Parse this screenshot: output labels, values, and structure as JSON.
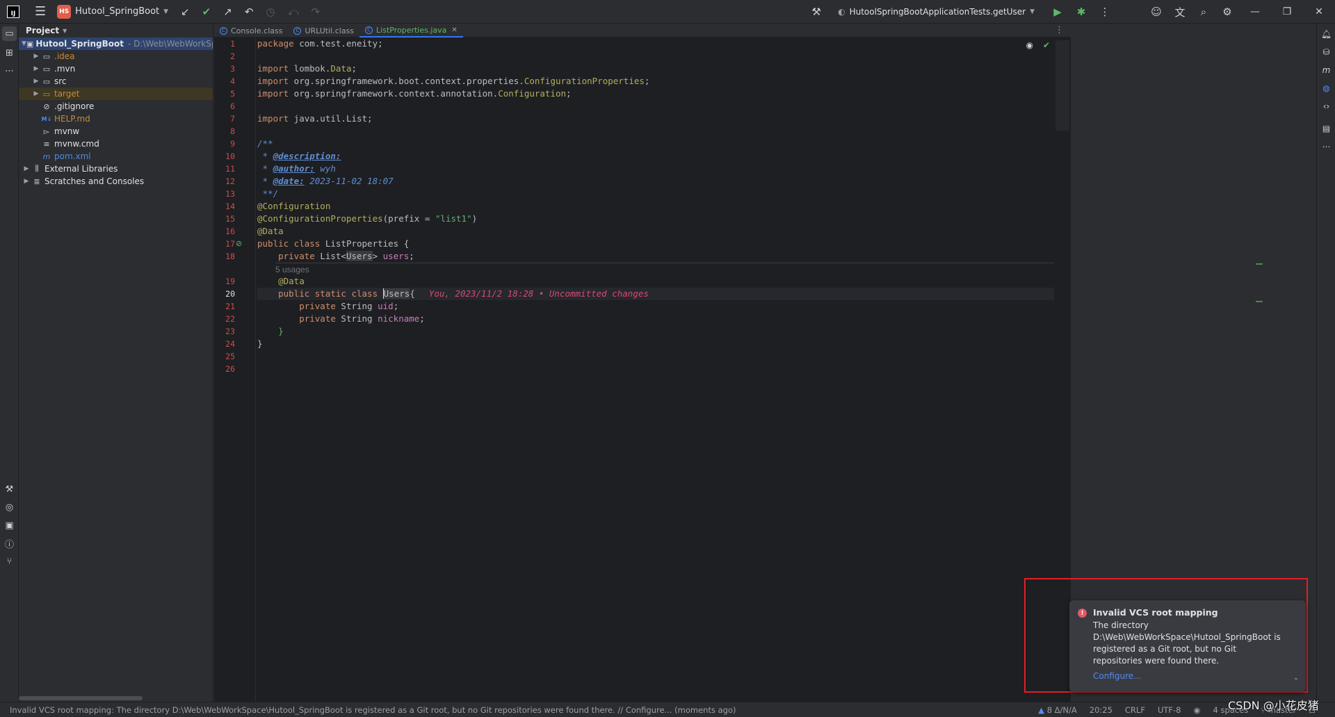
{
  "titlebar": {
    "app_logo": "IJ",
    "project_badge": "HS",
    "project_name": "Hutool_SpringBoot",
    "run_config": "HutoolSpringBootApplicationTests.getUser",
    "icons": [
      "hamburger-menu-icon",
      "vcs-update-icon",
      "vcs-commit-icon",
      "vcs-push-icon",
      "undo-icon",
      "history-icon",
      "rollback-icon",
      "redo-icon"
    ]
  },
  "project_panel": {
    "header": "Project",
    "tree": [
      {
        "label": "Hutool_SpringBoot",
        "path": "- D:\\Web\\WebWorkSpace\\H",
        "icon": "module-icon",
        "expanded": true
      },
      {
        "label": ".idea",
        "icon": "folder-icon",
        "color": "orange"
      },
      {
        "label": ".mvn",
        "icon": "folder-icon"
      },
      {
        "label": "src",
        "icon": "folder-icon"
      },
      {
        "label": "target",
        "icon": "folder-icon",
        "color": "orange"
      },
      {
        "label": ".gitignore",
        "icon": "ignore-file-icon"
      },
      {
        "label": "HELP.md",
        "icon": "markdown-icon",
        "color": "orange"
      },
      {
        "label": "mvnw",
        "icon": "terminal-file-icon"
      },
      {
        "label": "mvnw.cmd",
        "icon": "text-file-icon"
      },
      {
        "label": "pom.xml",
        "icon": "maven-icon",
        "color": "blue"
      },
      {
        "label": "External Libraries",
        "icon": "library-icon"
      },
      {
        "label": "Scratches and Consoles",
        "icon": "scratches-icon"
      }
    ]
  },
  "tabs": [
    {
      "label": "Console.class",
      "active": false
    },
    {
      "label": "URLUtil.class",
      "active": false
    },
    {
      "label": "ListProperties.java",
      "active": true
    }
  ],
  "editor": {
    "line_numbers": [
      "1",
      "2",
      "3",
      "4",
      "5",
      "6",
      "7",
      "8",
      "9",
      "10",
      "11",
      "12",
      "13",
      "14",
      "15",
      "16",
      "17",
      "18",
      "19",
      "20",
      "21",
      "22",
      "23",
      "24",
      "25",
      "26"
    ],
    "current_line": "20",
    "usages_hint": "5 usages",
    "blame": "You, 2023/11/2 18:28 • Uncommitted changes",
    "code": {
      "l1": [
        "package",
        " com.test.eneity;"
      ],
      "l3": [
        "import",
        " lombok.",
        "Data",
        ";"
      ],
      "l4": [
        "import",
        " org.springframework.boot.context.properties.",
        "ConfigurationProperties",
        ";"
      ],
      "l5": [
        "import",
        " org.springframework.context.annotation.",
        "Configuration",
        ";"
      ],
      "l7": [
        "import",
        " java.util.List;"
      ],
      "l9": "/**",
      "l10": [
        " * ",
        "@description:"
      ],
      "l11": [
        " * ",
        "@author:",
        " wyh"
      ],
      "l12": [
        " * ",
        "@date:",
        " 2023-11-02 18:07"
      ],
      "l13": " **/",
      "l14": "@Configuration",
      "l15": [
        "@ConfigurationProperties",
        "(prefix = ",
        "\"list1\"",
        ")"
      ],
      "l16": "@Data",
      "l17": [
        "public class",
        " ListProperties {"
      ],
      "l18": [
        "    private",
        " List<",
        "Users",
        "> ",
        "users",
        ";"
      ],
      "l19": "    @Data",
      "l20": [
        "    public static class",
        " ",
        "Users",
        "{"
      ],
      "l21": [
        "        private",
        " String ",
        "uid",
        ";"
      ],
      "l22": [
        "        private",
        " String ",
        "nickname",
        ";"
      ],
      "l23": "    }",
      "l24": "}"
    }
  },
  "notification": {
    "title": "Invalid VCS root mapping",
    "body": "The directory D:\\Web\\WebWorkSpace\\Hutool_SpringBoot is registered as a Git root, but no Git repositories were found there.",
    "link": "Configure..."
  },
  "statusbar": {
    "message": "Invalid VCS root mapping: The directory D:\\Web\\WebWorkSpace\\Hutool_SpringBoot is registered as a Git root, but no Git repositories were found there. // Configure... (moments ago)",
    "warnings": "8 Δ/N/A",
    "position": "20:25",
    "line_sep": "CRLF",
    "encoding": "UTF-8",
    "indent": "4 spaces",
    "branch": "master"
  },
  "watermark": "CSDN @小花皮猪"
}
